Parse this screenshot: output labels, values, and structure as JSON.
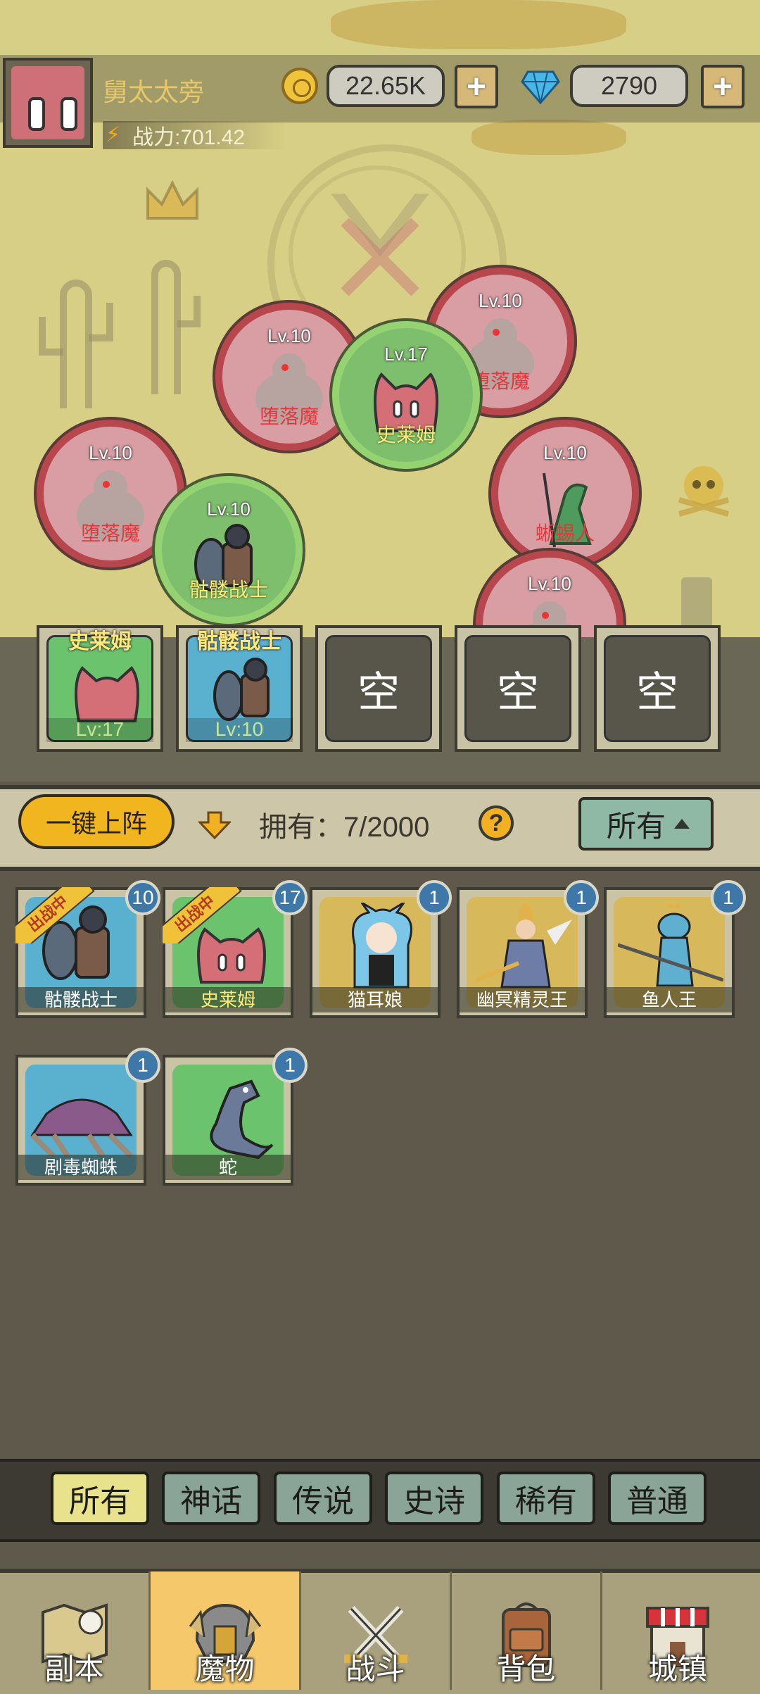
{
  "player": {
    "name": "舅太太旁",
    "power_label": "战力:701.42",
    "gold": "22.65K",
    "gems": "2790",
    "plus": "+"
  },
  "field_monsters": [
    {
      "level": "Lv.10",
      "name": "堕落魔",
      "team": "enemy"
    },
    {
      "level": "Lv.10",
      "name": "堕落魔",
      "team": "enemy"
    },
    {
      "level": "Lv.17",
      "name": "史莱姆",
      "team": "ally"
    },
    {
      "level": "Lv.10",
      "name": "堕落魔",
      "team": "enemy"
    },
    {
      "level": "Lv.10",
      "name": "骷髅战士",
      "team": "ally"
    },
    {
      "level": "Lv.10",
      "name": "蜥蜴人",
      "team": "enemy"
    },
    {
      "level": "Lv.10",
      "name": "",
      "team": "enemy"
    }
  ],
  "slots": [
    {
      "name": "史莱姆",
      "level": "Lv:17"
    },
    {
      "name": "骷髅战士",
      "level": "Lv:10"
    },
    {
      "empty": "空"
    },
    {
      "empty": "空"
    },
    {
      "empty": "空"
    }
  ],
  "controls": {
    "deploy_all": "一键上阵",
    "owned": "拥有：7/2000",
    "help": "?",
    "filter": "所有"
  },
  "cards": [
    {
      "name": "骷髅战士",
      "count": "10",
      "tag": "出战中"
    },
    {
      "name": "史莱姆",
      "count": "17",
      "tag": "出战中"
    },
    {
      "name": "猫耳娘",
      "count": "1"
    },
    {
      "name": "幽冥精灵王",
      "count": "1"
    },
    {
      "name": "鱼人王",
      "count": "1"
    },
    {
      "name": "剧毒蜘蛛",
      "count": "1"
    },
    {
      "name": "蛇",
      "count": "1"
    }
  ],
  "rarity_tabs": [
    "所有",
    "神话",
    "传说",
    "史诗",
    "稀有",
    "普通"
  ],
  "nav": [
    {
      "label": "副本",
      "icon": "map-icon"
    },
    {
      "label": "魔物",
      "icon": "helmet-icon"
    },
    {
      "label": "战斗",
      "icon": "crossed-swords-icon"
    },
    {
      "label": "背包",
      "icon": "backpack-icon"
    },
    {
      "label": "城镇",
      "icon": "shop-icon"
    }
  ],
  "colors": {
    "gold_accent": "#f1b520",
    "enemy_ring": "#b7474d",
    "ally_ring": "#95d272",
    "active_tab": "#e7e28b"
  }
}
